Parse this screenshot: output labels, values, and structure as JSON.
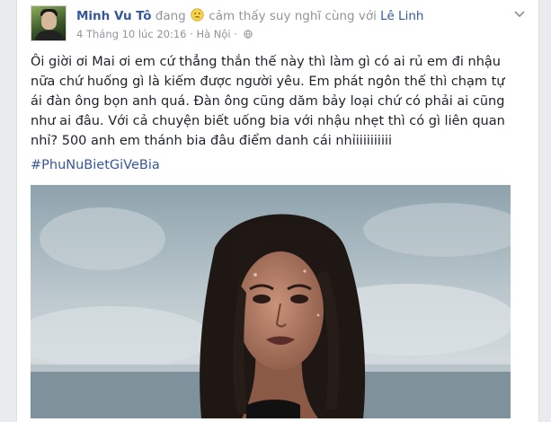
{
  "post": {
    "author": "Minh Vu Tô",
    "feeling_prefix": "đang",
    "feeling_text": "cảm thấy suy nghĩ cùng với",
    "tagged": "Lê Linh",
    "date": "4 Tháng 10 lúc 20:16",
    "separator": "·",
    "location": "Hà Nội",
    "separator2": "·",
    "icons": {
      "feeling": "thinking-emoji-icon",
      "audience": "globe-icon",
      "menu": "chevron-down-icon"
    },
    "text": "Ôi giời ơi Mai ơi em cứ thẳng thắn thế này thì làm gì có ai rủ em đi nhậu nữa chứ huống gì là kiếm được người yêu. Em phát ngôn thế thì chạm tự ái đàn ông bọn anh quá. Đàn ông cũng dăm bảy loại chứ có phải ai cũng như ai đâu. Với cả chuyện biết uống bia với nhậu nhẹt thì có gì liên quan nhỉ? 500 anh em thánh bia đâu điểm danh cái nhỉiiiiiiiiii",
    "hashtag": "#PhuNuBietGiVeBia"
  },
  "colors": {
    "link": "#365899",
    "meta": "#90949c",
    "text": "#1d2129",
    "background": "#e9ebee"
  }
}
